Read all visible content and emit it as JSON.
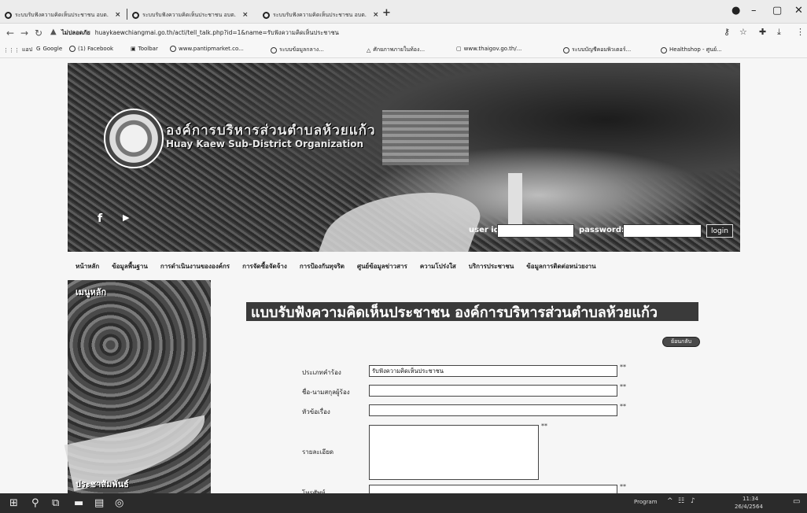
{
  "browser": {
    "tabs": [
      {
        "title": "ระบบรับฟังความคิดเห็นประชาชน อบต."
      },
      {
        "title": "ระบบรับฟังความคิดเห็นประชาชน อบต."
      },
      {
        "title": "ระบบรับฟังความคิดเห็นประชาชน อบต."
      }
    ],
    "url_prefix": "ไม่ปลอดภัย",
    "url": "huaykaewchiangmai.go.th/acti/tell_talk.php?id=1&name=รับฟังความคิดเห็นประชาชน",
    "bookmarks": [
      "แอป",
      "Google",
      "(1) Facebook",
      "Toolbar",
      "www.pantipmarket.co...",
      "ระบบข้อมูลกลาง...",
      "ศักยภาพภายในท้อง...",
      "www.thaigov.go.th/...",
      "ระบบบัญชีคอมพิวเตอร์...",
      "Healthshop - ศูนย์..."
    ]
  },
  "banner": {
    "org_name_th": "องค์การบริหารส่วนตำบลห้วยแก้ว",
    "org_name_en": "Huay Kaew Sub-District Organization",
    "username_label": "user id:",
    "password_label": "password:",
    "login_label": "login",
    "social": [
      "f",
      "▶"
    ]
  },
  "menu": {
    "items": [
      "หน้าหลัก",
      "ข้อมูลพื้นฐาน",
      "การดำเนินงานขององค์กร",
      "การจัดซื้อจัดจ้าง",
      "การป้องกันทุจริต",
      "ศูนย์ข้อมูลข่าวสาร",
      "ความโปร่งใส",
      "บริการประชาชน",
      "ข้อมูลการติดต่อหน่วยงาน"
    ]
  },
  "sidebar": {
    "section1": "เมนูหลัก",
    "section2": "ประชาสัมพันธ์"
  },
  "page": {
    "heading": "แบบรับฟังความคิดเห็นประชาชน องค์การบริหารส่วนตำบลห้วยแก้ว",
    "back_label": "ย้อนกลับ"
  },
  "form": {
    "type_label": "ประเภทคำร้อง",
    "type_value": "รับฟังความคิดเห็นประชาชน",
    "name_label": "ชื่อ-นามสกุลผู้ร้อง",
    "subject_label": "หัวข้อเรื่อง",
    "detail_label": "รายละเอียด",
    "phone_label": "โทรศัพท์",
    "required_mark": "**"
  },
  "taskbar": {
    "tray_text": "Program",
    "time": "11:34",
    "date": "26/4/2564"
  }
}
